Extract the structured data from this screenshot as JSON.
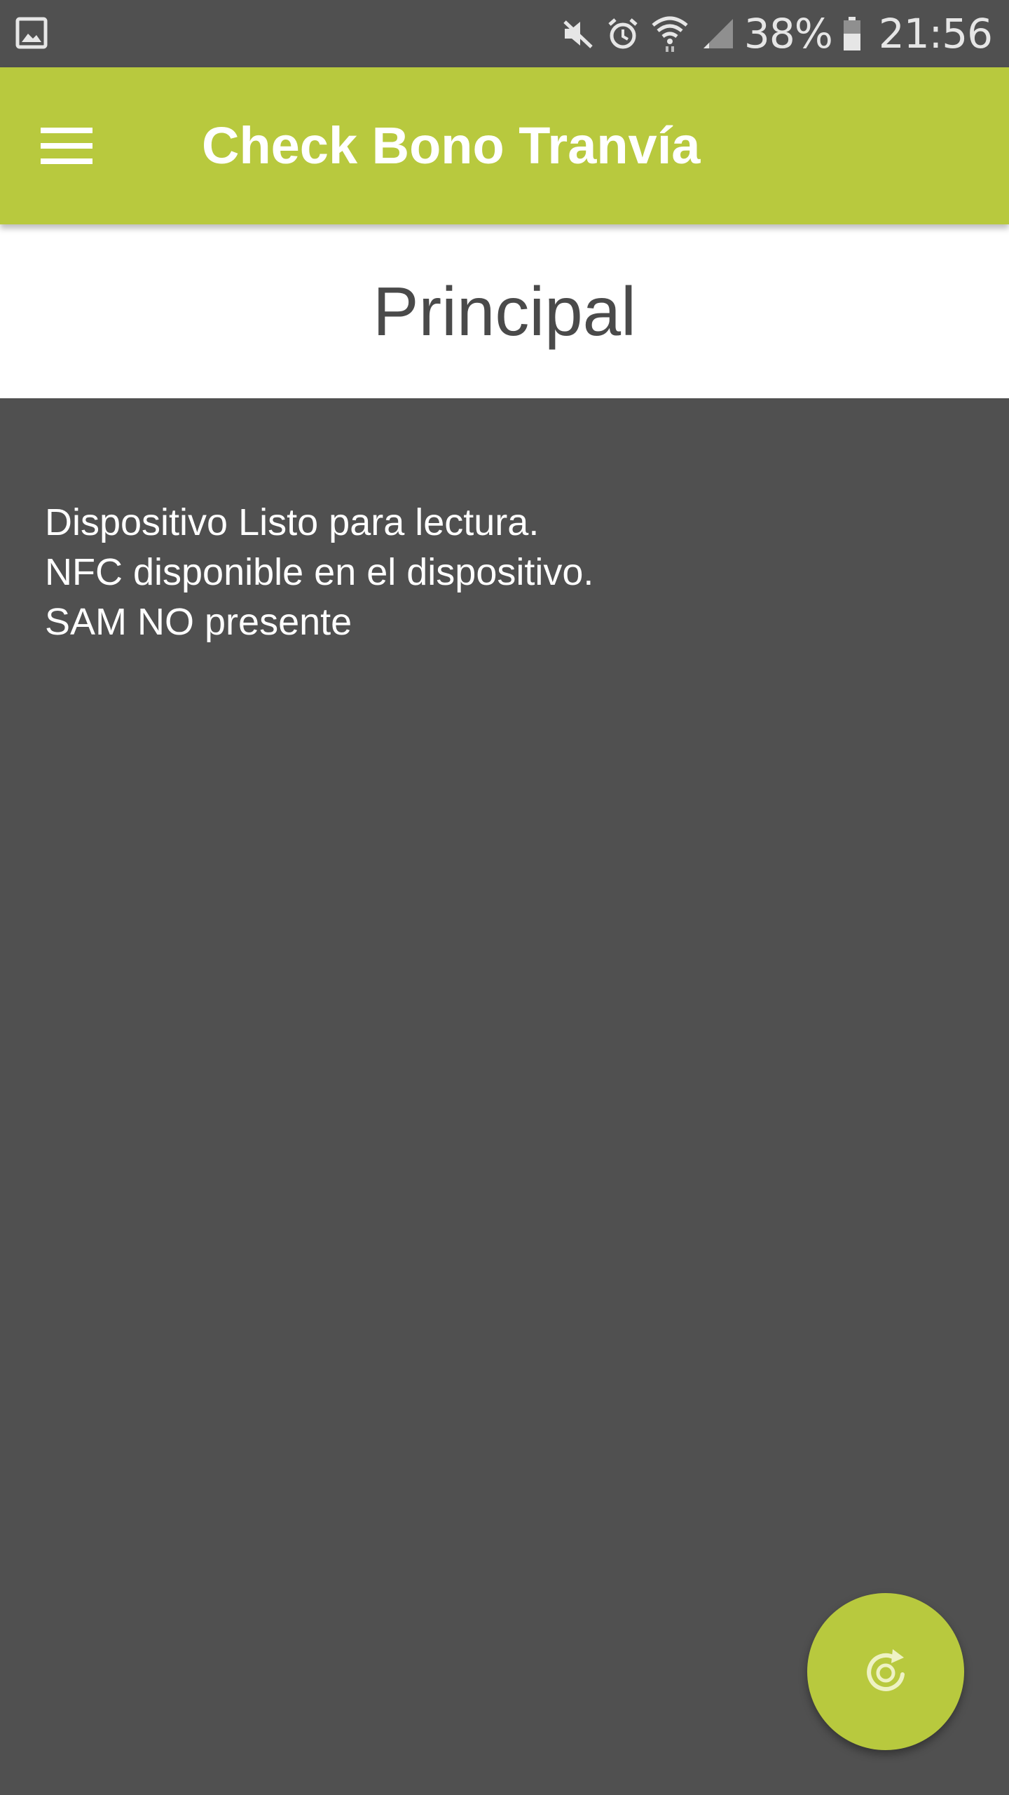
{
  "status_bar": {
    "battery_percent": "38%",
    "time": "21:56",
    "icons": [
      "gallery-notification-icon",
      "mute-icon",
      "alarm-icon",
      "wifi-icon",
      "signal-icon",
      "battery-icon"
    ]
  },
  "app_bar": {
    "title": "Check Bono Tranvía",
    "menu_icon": "hamburger-menu-icon",
    "background": "#b8c93e"
  },
  "section": {
    "title": "Principal"
  },
  "status_messages": [
    "Dispositivo Listo para lectura.",
    "NFC disponible en el dispositivo.",
    "SAM NO presente"
  ],
  "fab": {
    "icon": "refresh-icon",
    "background": "#b8c93e"
  },
  "colors": {
    "accent": "#b8c93e",
    "content_background": "#505050",
    "header_background": "#ffffff"
  }
}
